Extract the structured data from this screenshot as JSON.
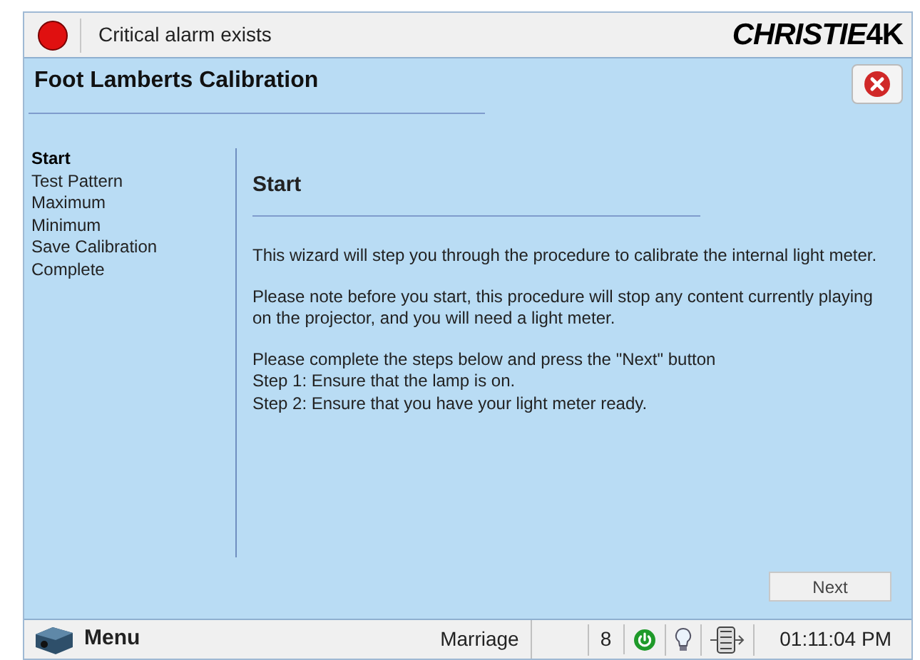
{
  "top_bar": {
    "alarm": {
      "text": "Critical alarm exists",
      "color": "#e01010"
    },
    "logo": {
      "brand": "CHRISTIE",
      "suffix": "4K"
    }
  },
  "dialog": {
    "title": "Foot Lamberts Calibration"
  },
  "steps": [
    {
      "label": "Start",
      "selected": true
    },
    {
      "label": "Test Pattern",
      "selected": false
    },
    {
      "label": "Maximum",
      "selected": false
    },
    {
      "label": "Minimum",
      "selected": false
    },
    {
      "label": "Save Calibration",
      "selected": false
    },
    {
      "label": "Complete",
      "selected": false
    }
  ],
  "page": {
    "heading": "Start",
    "paragraphs": [
      {
        "lines": [
          "This wizard will step you through the procedure to calibrate the internal light meter."
        ]
      },
      {
        "lines": [
          "Please note before you start, this procedure will stop any content currently playing on the projector, and you will need a light meter."
        ]
      },
      {
        "lines": [
          "Please complete the steps below and press the \"Next\" button",
          "Step 1: Ensure that the lamp is on.",
          "Step 2: Ensure that you have your light meter ready."
        ]
      }
    ]
  },
  "buttons": {
    "next": "Next"
  },
  "status_bar": {
    "menu": "Menu",
    "show": "Marriage",
    "count": "8",
    "time": "01:11:04 PM"
  }
}
